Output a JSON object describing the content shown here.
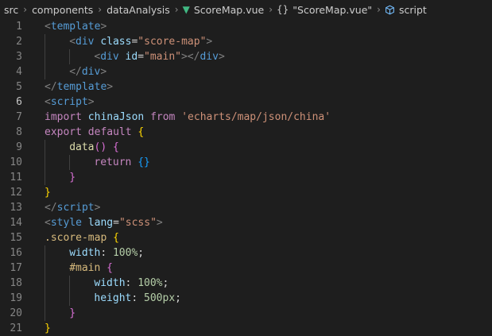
{
  "breadcrumb": {
    "items": [
      "src",
      "components",
      "dataAnalysis",
      "ScoreMap.vue",
      "\"ScoreMap.vue\"",
      "script"
    ],
    "icons": {
      "file": "vue-logo-icon",
      "component": "braces-icon",
      "symbol": "cube-icon"
    },
    "separator": "chevron-right-icon"
  },
  "editor": {
    "current_line": 6,
    "lines": [
      {
        "n": "1",
        "tokens": [
          [
            "tk-punct",
            "<"
          ],
          [
            "tk-tag",
            "template"
          ],
          [
            "tk-punct",
            ">"
          ]
        ],
        "indent": 0
      },
      {
        "n": "2",
        "tokens": [
          [
            "tk-punct",
            "<"
          ],
          [
            "tk-tag",
            "div"
          ],
          [
            "tk-default",
            " "
          ],
          [
            "tk-attr",
            "class"
          ],
          [
            "tk-default",
            "="
          ],
          [
            "tk-str",
            "\"score-map\""
          ],
          [
            "tk-punct",
            ">"
          ]
        ],
        "indent": 1
      },
      {
        "n": "3",
        "tokens": [
          [
            "tk-punct",
            "<"
          ],
          [
            "tk-tag",
            "div"
          ],
          [
            "tk-default",
            " "
          ],
          [
            "tk-attr",
            "id"
          ],
          [
            "tk-default",
            "="
          ],
          [
            "tk-str",
            "\"main\""
          ],
          [
            "tk-punct",
            "></"
          ],
          [
            "tk-tag",
            "div"
          ],
          [
            "tk-punct",
            ">"
          ]
        ],
        "indent": 2
      },
      {
        "n": "4",
        "tokens": [
          [
            "tk-punct",
            "</"
          ],
          [
            "tk-tag",
            "div"
          ],
          [
            "tk-punct",
            ">"
          ]
        ],
        "indent": 1
      },
      {
        "n": "5",
        "tokens": [
          [
            "tk-punct",
            "</"
          ],
          [
            "tk-tag",
            "template"
          ],
          [
            "tk-punct",
            ">"
          ]
        ],
        "indent": 0
      },
      {
        "n": "6",
        "tokens": [
          [
            "tk-punct",
            "<"
          ],
          [
            "tk-tag",
            "script"
          ],
          [
            "tk-punct",
            ">"
          ]
        ],
        "indent": 0
      },
      {
        "n": "7",
        "tokens": [
          [
            "tk-kw",
            "import"
          ],
          [
            "tk-default",
            " "
          ],
          [
            "tk-var",
            "chinaJson"
          ],
          [
            "tk-default",
            " "
          ],
          [
            "tk-kw",
            "from"
          ],
          [
            "tk-default",
            " "
          ],
          [
            "tk-str",
            "'echarts/map/json/china'"
          ]
        ],
        "indent": 0
      },
      {
        "n": "8",
        "tokens": [
          [
            "tk-kw",
            "export"
          ],
          [
            "tk-default",
            " "
          ],
          [
            "tk-kw",
            "default"
          ],
          [
            "tk-default",
            " "
          ],
          [
            "tk-brace",
            "{"
          ]
        ],
        "indent": 0
      },
      {
        "n": "9",
        "tokens": [
          [
            "tk-fn",
            "data"
          ],
          [
            "tk-brace2",
            "()"
          ],
          [
            "tk-default",
            " "
          ],
          [
            "tk-brace2",
            "{"
          ]
        ],
        "indent": 1
      },
      {
        "n": "10",
        "tokens": [
          [
            "tk-kw",
            "return"
          ],
          [
            "tk-default",
            " "
          ],
          [
            "tk-brace3",
            "{}"
          ]
        ],
        "indent": 2
      },
      {
        "n": "11",
        "tokens": [
          [
            "tk-brace2",
            "}"
          ]
        ],
        "indent": 1
      },
      {
        "n": "12",
        "tokens": [
          [
            "tk-brace",
            "}"
          ]
        ],
        "indent": 0
      },
      {
        "n": "13",
        "tokens": [
          [
            "tk-punct",
            "</"
          ],
          [
            "tk-tag",
            "script"
          ],
          [
            "tk-punct",
            ">"
          ]
        ],
        "indent": 0
      },
      {
        "n": "14",
        "tokens": [
          [
            "tk-punct",
            "<"
          ],
          [
            "tk-tag",
            "style"
          ],
          [
            "tk-default",
            " "
          ],
          [
            "tk-attr",
            "lang"
          ],
          [
            "tk-default",
            "="
          ],
          [
            "tk-str",
            "\"scss\""
          ],
          [
            "tk-punct",
            ">"
          ]
        ],
        "indent": 0
      },
      {
        "n": "15",
        "tokens": [
          [
            "tk-sel",
            ".score-map"
          ],
          [
            "tk-default",
            " "
          ],
          [
            "tk-brace",
            "{"
          ]
        ],
        "indent": 0
      },
      {
        "n": "16",
        "tokens": [
          [
            "tk-attr",
            "width"
          ],
          [
            "tk-default",
            ": "
          ],
          [
            "tk-num",
            "100%"
          ],
          [
            "tk-default",
            ";"
          ]
        ],
        "indent": 1
      },
      {
        "n": "17",
        "tokens": [
          [
            "tk-sel",
            "#main"
          ],
          [
            "tk-default",
            " "
          ],
          [
            "tk-brace2",
            "{"
          ]
        ],
        "indent": 1
      },
      {
        "n": "18",
        "tokens": [
          [
            "tk-attr",
            "width"
          ],
          [
            "tk-default",
            ": "
          ],
          [
            "tk-num",
            "100%"
          ],
          [
            "tk-default",
            ";"
          ]
        ],
        "indent": 2
      },
      {
        "n": "19",
        "tokens": [
          [
            "tk-attr",
            "height"
          ],
          [
            "tk-default",
            ": "
          ],
          [
            "tk-num",
            "500px"
          ],
          [
            "tk-default",
            ";"
          ]
        ],
        "indent": 2
      },
      {
        "n": "20",
        "tokens": [
          [
            "tk-brace2",
            "}"
          ]
        ],
        "indent": 1
      },
      {
        "n": "21",
        "tokens": [
          [
            "tk-brace",
            "}"
          ]
        ],
        "indent": 0
      }
    ]
  }
}
